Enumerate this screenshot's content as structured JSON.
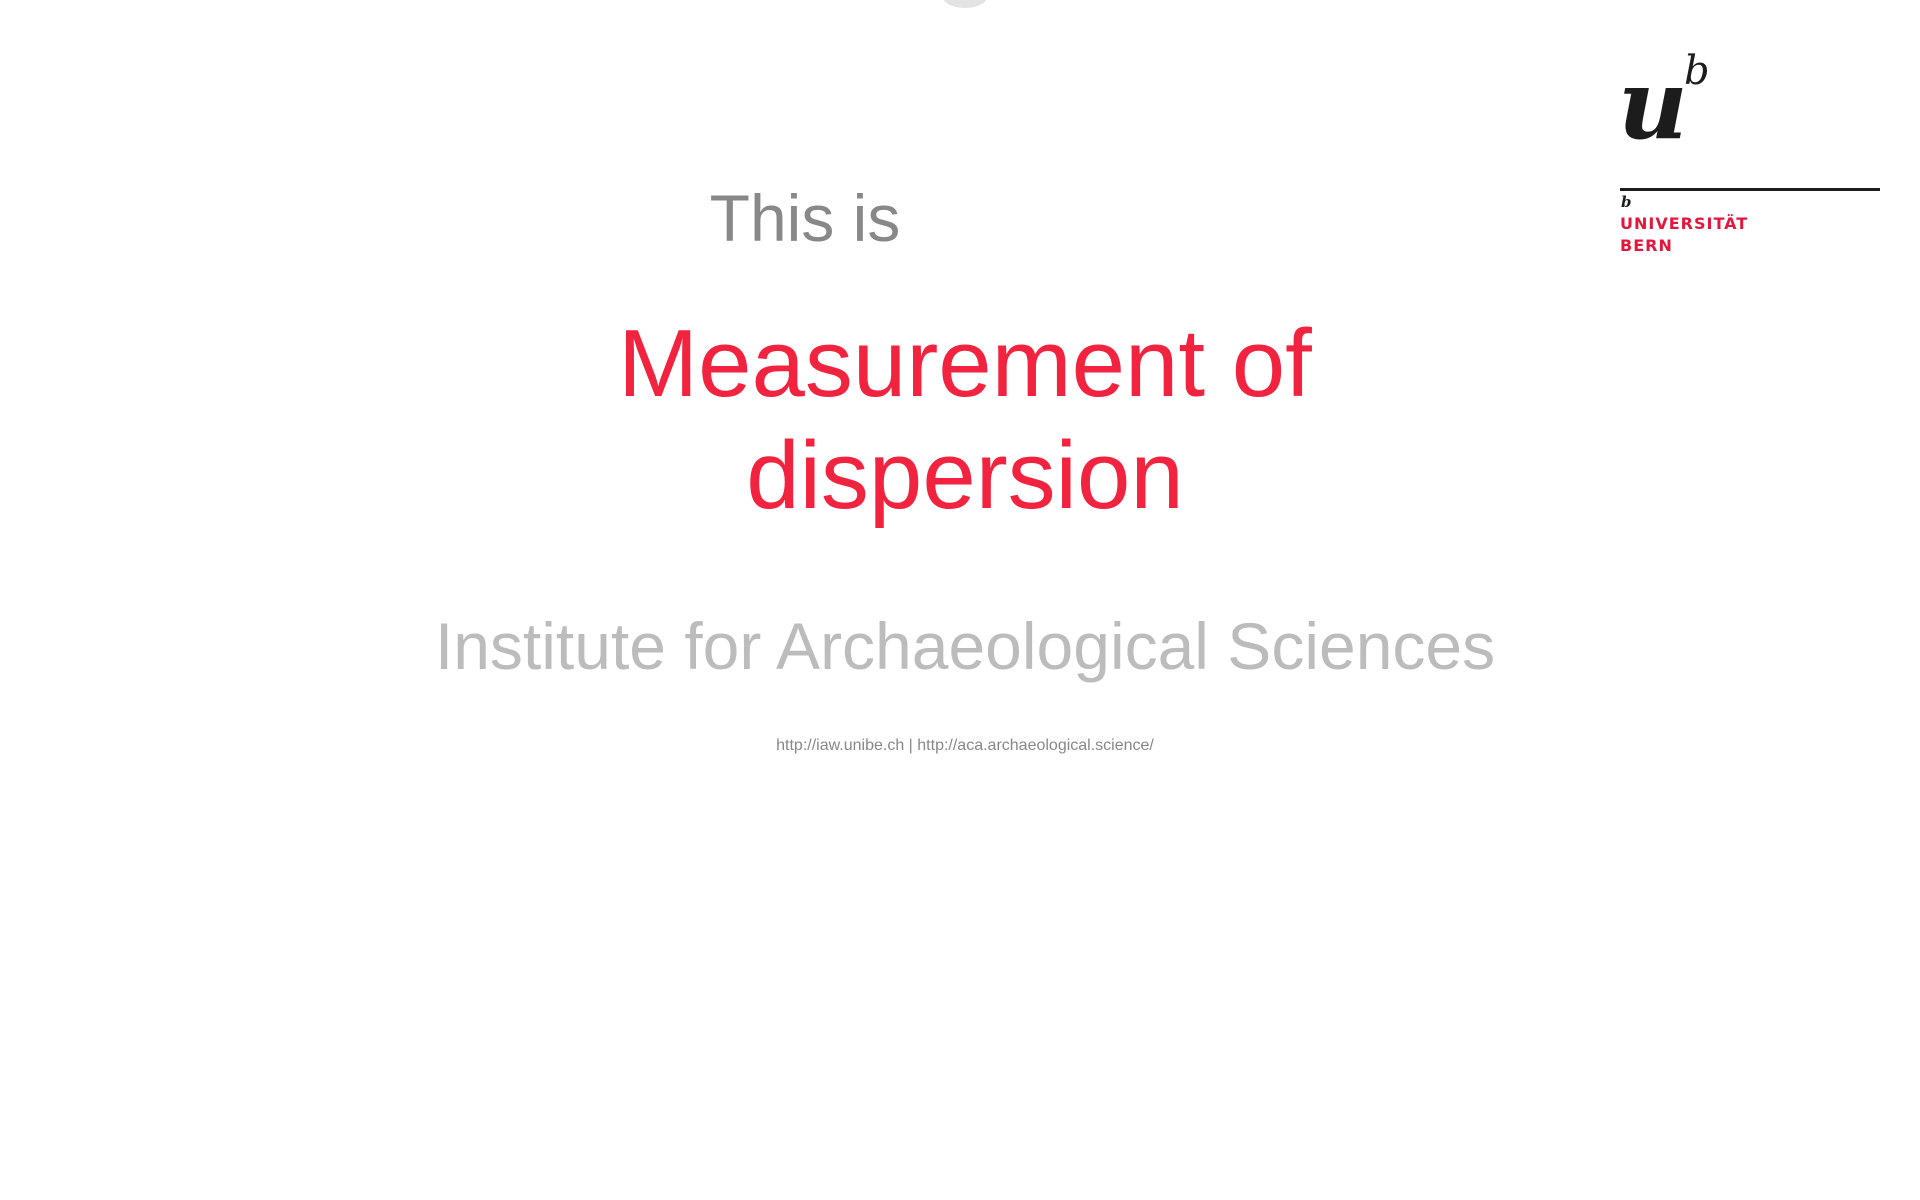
{
  "slide": {
    "intro": "This is",
    "title_line1": "Measurement of",
    "title_line2": "dispersion",
    "institute": "Institute for Archaeological Sciences",
    "urls": "http://iaw.unibe.ch | http://aca.archaeological.science/"
  },
  "logo": {
    "monogram": "ub",
    "small_b": "b",
    "line1": "UNIVERSITÄT",
    "line2": "BERN",
    "brand_color": "#e3173e",
    "ink_color": "#1c1c1c"
  },
  "colors": {
    "title": "#f2233f",
    "intro": "#888888",
    "institute": "#bcbcbc",
    "background": "#ffffff"
  }
}
